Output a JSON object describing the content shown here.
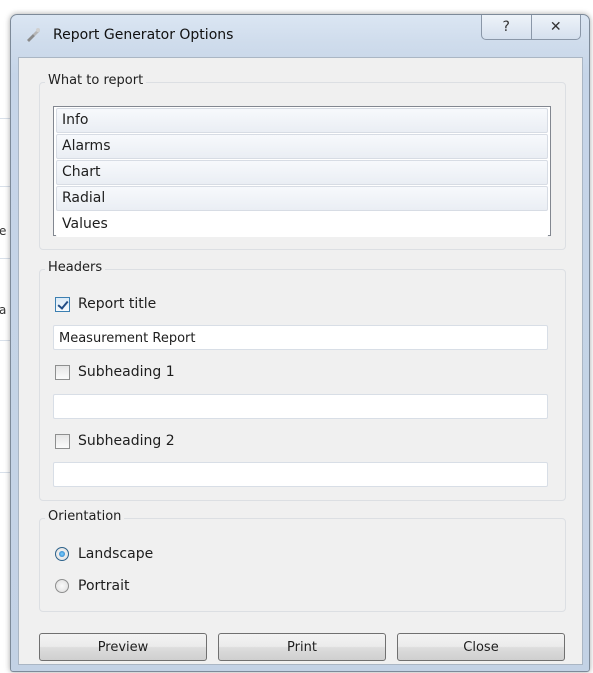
{
  "background": {
    "fragment_1": "e",
    "fragment_2": "a"
  },
  "window": {
    "title": "Report Generator Options",
    "help_glyph": "?",
    "close_glyph": "✕"
  },
  "what_to_report": {
    "label": "What to report",
    "items": [
      "Info",
      "Alarms",
      "Chart",
      "Radial",
      "Values"
    ]
  },
  "headers": {
    "label": "Headers",
    "report_title": {
      "label": "Report title",
      "checked": true,
      "value": "Measurement Report"
    },
    "subheading_1": {
      "label": "Subheading 1",
      "checked": false,
      "value": ""
    },
    "subheading_2": {
      "label": "Subheading 2",
      "checked": false,
      "value": ""
    }
  },
  "orientation": {
    "label": "Orientation",
    "options": [
      {
        "label": "Landscape",
        "selected": true
      },
      {
        "label": "Portrait",
        "selected": false
      }
    ]
  },
  "buttons": {
    "preview": "Preview",
    "print": "Print",
    "close": "Close"
  },
  "colors": {
    "title_bar": "#cfdcec",
    "client_bg": "#f0f0f0",
    "accent": "#1d74c1"
  }
}
